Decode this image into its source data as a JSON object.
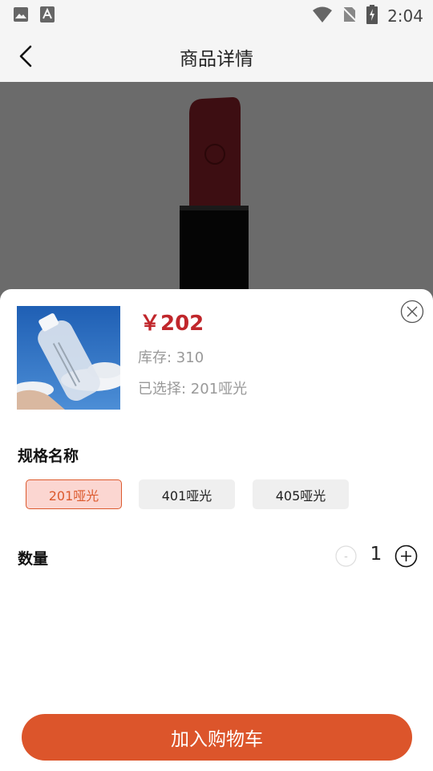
{
  "status_bar": {
    "time": "2:04",
    "icons": [
      "image-icon",
      "font-a-icon",
      "wifi-icon",
      "no-sim-icon",
      "battery-charging-icon"
    ]
  },
  "header": {
    "title": "商品详情",
    "back_icon": "chevron-left-icon"
  },
  "product": {
    "price": "￥202",
    "stock": "库存: 310",
    "selected": "已选择: 201哑光"
  },
  "specs": {
    "title": "规格名称",
    "options": [
      "201哑光",
      "401哑光",
      "405哑光"
    ],
    "selected_index": 0
  },
  "quantity": {
    "title": "数量",
    "minus_label": "-",
    "value": "1",
    "plus_label": "+"
  },
  "actions": {
    "add_to_cart": "加入购物车"
  },
  "colors": {
    "accent": "#dc552b",
    "price_red": "#c0262b",
    "overlay": "#6b6b6b",
    "selected_bg": "#fbd6d1"
  }
}
